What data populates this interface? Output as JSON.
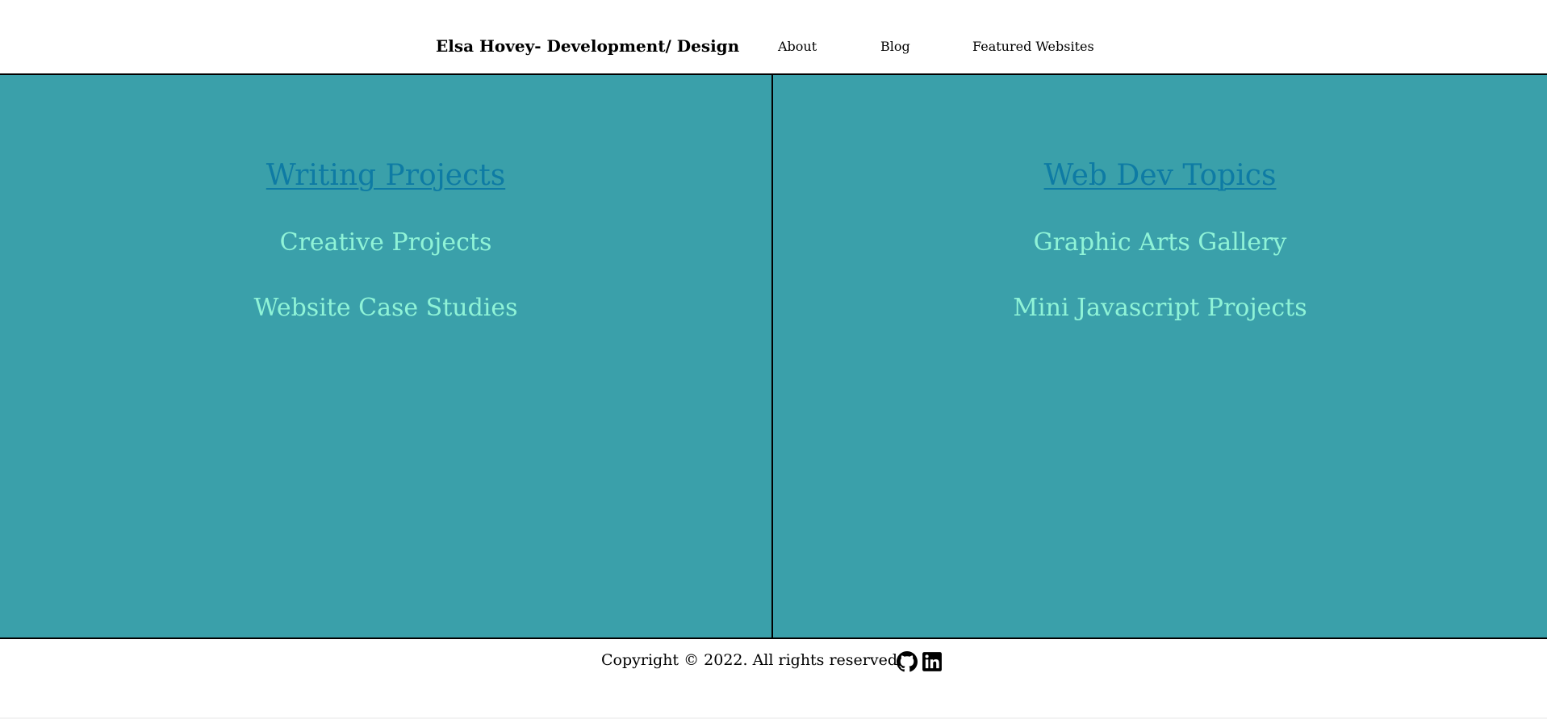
{
  "header": {
    "brand": "Elsa Hovey- Development/ Design",
    "nav": {
      "about": "About",
      "blog": "Blog",
      "featured": "Featured Websites"
    }
  },
  "left_panel": {
    "heading": "Writing Projects",
    "links": [
      "Creative Projects",
      "Website Case Studies"
    ]
  },
  "right_panel": {
    "heading": "Web Dev Topics",
    "links": [
      "Graphic Arts Gallery",
      "Mini Javascript Projects"
    ]
  },
  "footer": {
    "copyright": "Copyright © 2022. All rights reserved.",
    "icons": [
      "github-icon",
      "linkedin-icon"
    ]
  },
  "colors": {
    "main_background": "#3aa0aa",
    "heading_link": "#0e7ba4",
    "panel_link": "#8ff3d7",
    "text": "#000000"
  }
}
